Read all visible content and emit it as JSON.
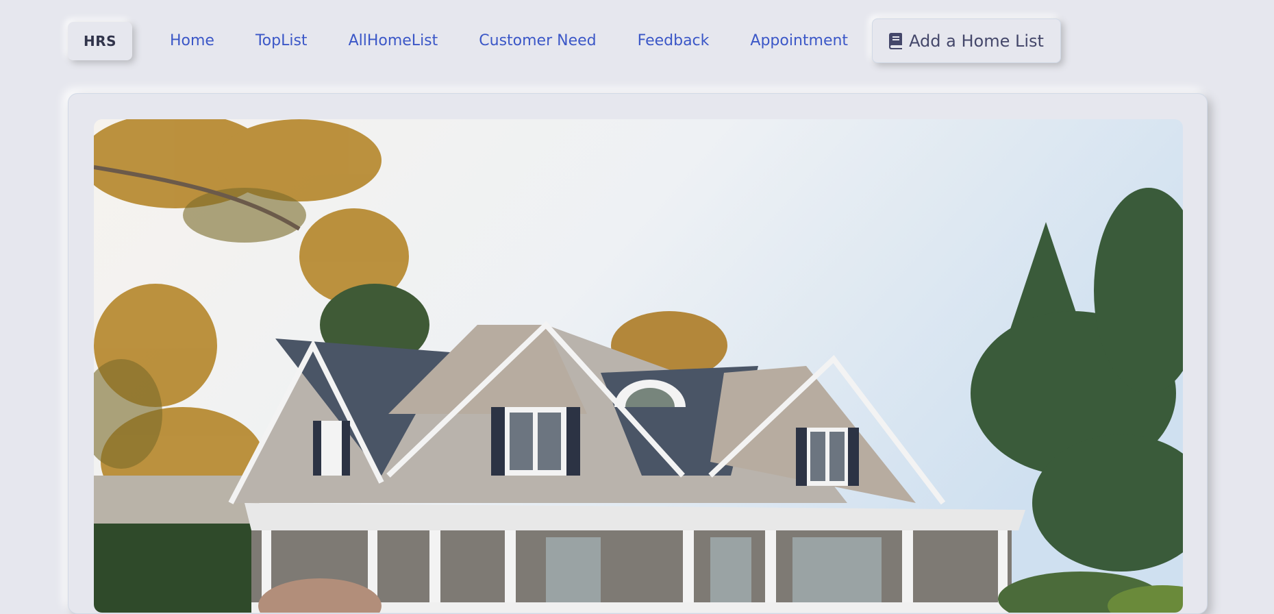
{
  "brand": {
    "label": "HRS"
  },
  "nav": {
    "links": [
      "Home",
      "TopList",
      "AllHomeList",
      "Customer Need",
      "Feedback",
      "Appointment"
    ],
    "add_button_label": "Add a Home List",
    "add_button_icon": "book-icon"
  },
  "hero": {
    "image": "house-photo"
  },
  "colors": {
    "background": "#e6e7ee",
    "link": "#3b57c7",
    "text": "#44476a"
  }
}
